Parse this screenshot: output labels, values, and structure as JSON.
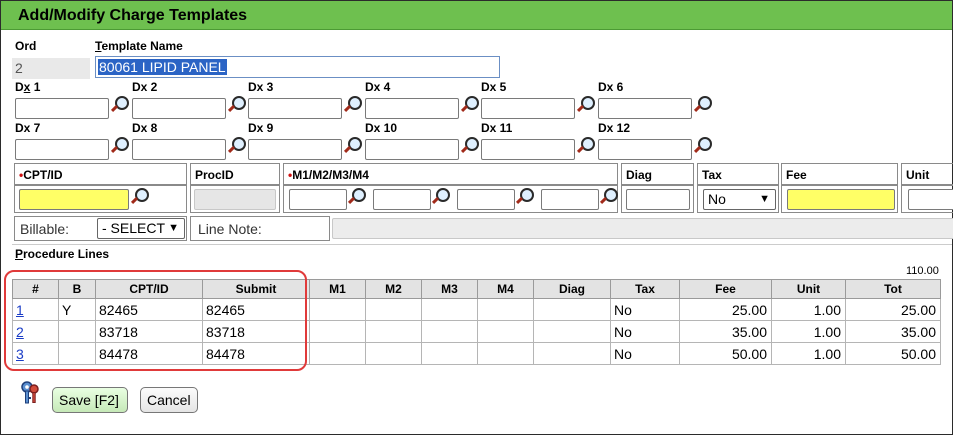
{
  "window": {
    "title": "Add/Modify Charge Templates"
  },
  "header": {
    "ord_label": "Ord",
    "ord_value": "2",
    "template_label_prefix": "",
    "template_label_underlined": "T",
    "template_label_rest": "emplate Name",
    "template_value": "80061 LIPID PANEL"
  },
  "dx": [
    {
      "pre": "D",
      "u": "x",
      "post": " 1"
    },
    {
      "pre": "Dx 2",
      "u": "",
      "post": ""
    },
    {
      "pre": "Dx 3",
      "u": "",
      "post": ""
    },
    {
      "pre": "Dx 4",
      "u": "",
      "post": ""
    },
    {
      "pre": "Dx 5",
      "u": "",
      "post": ""
    },
    {
      "pre": "Dx 6",
      "u": "",
      "post": ""
    },
    {
      "pre": "Dx 7",
      "u": "",
      "post": ""
    },
    {
      "pre": "Dx 8",
      "u": "",
      "post": ""
    },
    {
      "pre": "Dx 9",
      "u": "",
      "post": ""
    },
    {
      "pre": "Dx 10",
      "u": "",
      "post": ""
    },
    {
      "pre": "Dx 11",
      "u": "",
      "post": ""
    },
    {
      "pre": "Dx 12",
      "u": "",
      "post": ""
    }
  ],
  "entry": {
    "cpt_label": "CPT/ID",
    "proc_label": "ProcID",
    "mods_label": "M1/M2/M3/M4",
    "diag_label": "Diag",
    "tax_label": "Tax",
    "tax_value": "No",
    "fee_label": "Fee",
    "unit_label": "Unit",
    "required_marker": "•"
  },
  "billable": {
    "label": "Billable:",
    "value": "- SELECT -",
    "line_note_label": "Line Note:"
  },
  "procedure_lines": {
    "title_u": "P",
    "title_rest": "rocedure Lines",
    "total": "110.00",
    "columns": [
      "#",
      "B",
      "CPT/ID",
      "Submit",
      "M1",
      "M2",
      "M3",
      "M4",
      "Diag",
      "Tax",
      "Fee",
      "Unit",
      "Tot"
    ],
    "rows": [
      {
        "num": "1",
        "b": "Y",
        "cpt": "82465",
        "submit": "82465",
        "m1": "",
        "m2": "",
        "m3": "",
        "m4": "",
        "diag": "",
        "tax": "No",
        "fee": "25.00",
        "unit": "1.00",
        "tot": "25.00"
      },
      {
        "num": "2",
        "b": "",
        "cpt": "83718",
        "submit": "83718",
        "m1": "",
        "m2": "",
        "m3": "",
        "m4": "",
        "diag": "",
        "tax": "No",
        "fee": "35.00",
        "unit": "1.00",
        "tot": "35.00"
      },
      {
        "num": "3",
        "b": "",
        "cpt": "84478",
        "submit": "84478",
        "m1": "",
        "m2": "",
        "m3": "",
        "m4": "",
        "diag": "",
        "tax": "No",
        "fee": "50.00",
        "unit": "1.00",
        "tot": "50.00"
      }
    ]
  },
  "buttons": {
    "save": "Save [F2]",
    "cancel": "Cancel"
  },
  "icons": {
    "lookup": "magnifier-icon",
    "keys": "keys-icon"
  },
  "colors": {
    "titlebar": "#6ec04f",
    "required_field": "#ffff66",
    "highlight": "#e03a3a",
    "link": "#1a3cc6"
  }
}
